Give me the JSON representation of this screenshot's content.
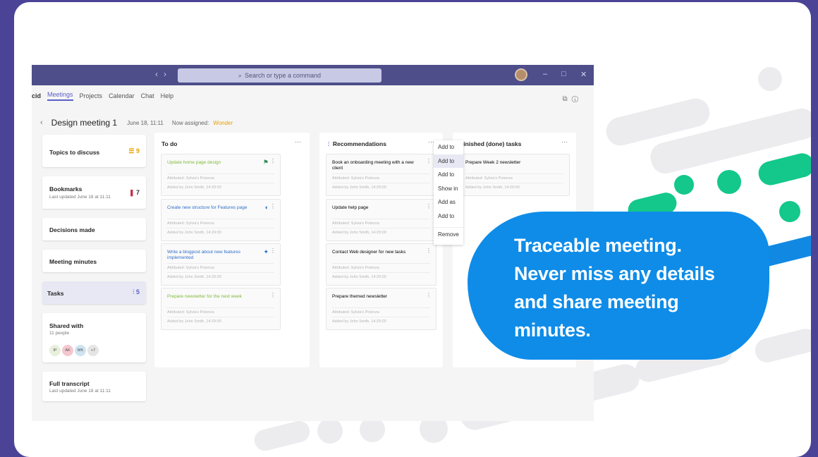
{
  "titlebar": {
    "nav_back": "‹",
    "nav_forward": "›",
    "search_placeholder": "Search or type a command",
    "minimize": "–",
    "maximize": "□",
    "close": "✕"
  },
  "menubar": {
    "app": "cid",
    "items": [
      "Meetings",
      "Projects",
      "Calendar",
      "Chat",
      "Help"
    ]
  },
  "header": {
    "back": "‹",
    "title": "Design meeting 1",
    "date": "June 18, 11:11",
    "assigned_label": "Now assigned:",
    "assigned_value": "Wonder"
  },
  "sidebar": {
    "topics": {
      "label": "Topics to discuss",
      "count": "9"
    },
    "bookmarks": {
      "label": "Bookmarks",
      "sub": "Last updated June 18 at 11:11",
      "count": "7"
    },
    "decisions": {
      "label": "Decisions made"
    },
    "minutes": {
      "label": "Meeting minutes"
    },
    "tasks": {
      "label": "Tasks",
      "count": "5"
    },
    "shared": {
      "label": "Shared with",
      "sub": "11 people",
      "avatars": [
        "IP",
        "AK",
        "MK",
        "+7"
      ]
    },
    "transcript": {
      "label": "Full transcript",
      "sub": "Last updated June 18 at 11:11"
    }
  },
  "columns": {
    "todo": {
      "title": "To do",
      "tasks": [
        {
          "title": "Update home page design",
          "assignee": "Attributed: Sylvia's Potenza",
          "added": "Added by John Smith, 14:29:00",
          "color": "#7fba3a"
        },
        {
          "title": "Create new structure for Features page",
          "assignee": "Attributed: Sylvia's Potenza",
          "added": "Added by John Smith, 14:29:00",
          "color": "#2f6fc9"
        },
        {
          "title": "Write a blogpost about new features implemented",
          "assignee": "Attributed: Sylvia's Potenza",
          "added": "Added by John Smith, 14:29:00",
          "color": "#2f6fc9"
        },
        {
          "title": "Prepare newsletter for the next week",
          "assignee": "Attributed: Sylvia's Potenza",
          "added": "Added by John Smith, 14:29:00",
          "color": "#7fba3a"
        }
      ]
    },
    "recommendations": {
      "title": "Recommendations",
      "tasks": [
        {
          "title": "Book an onboarding meeting with a new client",
          "assignee": "Attributed: Sylvia's Potenza",
          "added": "Added by John Smith, 14:29:00"
        },
        {
          "title": "Update help page",
          "assignee": "Attributed: Sylvia's Potenza",
          "added": "Added by John Smith, 14:29:00"
        },
        {
          "title": "Contact Web designer for new tasks",
          "assignee": "Attributed: Sylvia's Potenza",
          "added": "Added by John Smith, 14:29:00"
        },
        {
          "title": "Prepare themed newsletter",
          "assignee": "Attributed: Sylvia's Potenza",
          "added": "Added by John Smith, 14:29:00"
        }
      ]
    },
    "finished": {
      "title": "Finished (done) tasks",
      "tasks": [
        {
          "title": "Prepare Week 2 newsletter",
          "assignee": "Attributed: Sylvia's Potenza",
          "added": "Added by John Smith, 14:29:00"
        }
      ]
    }
  },
  "context_menu": {
    "items": [
      "Add to",
      "Add to",
      "Add to",
      "Show in",
      "Add as",
      "Add to",
      "Remove"
    ]
  },
  "bubble": {
    "lines": [
      "Traceable meeting.",
      "Never miss any details",
      "and share meeting",
      "minutes."
    ]
  },
  "colors": {
    "accent": "#5b5fc7",
    "bubble": "#0e8ce8",
    "green": "#13c88a",
    "bg": "#4b4496"
  }
}
